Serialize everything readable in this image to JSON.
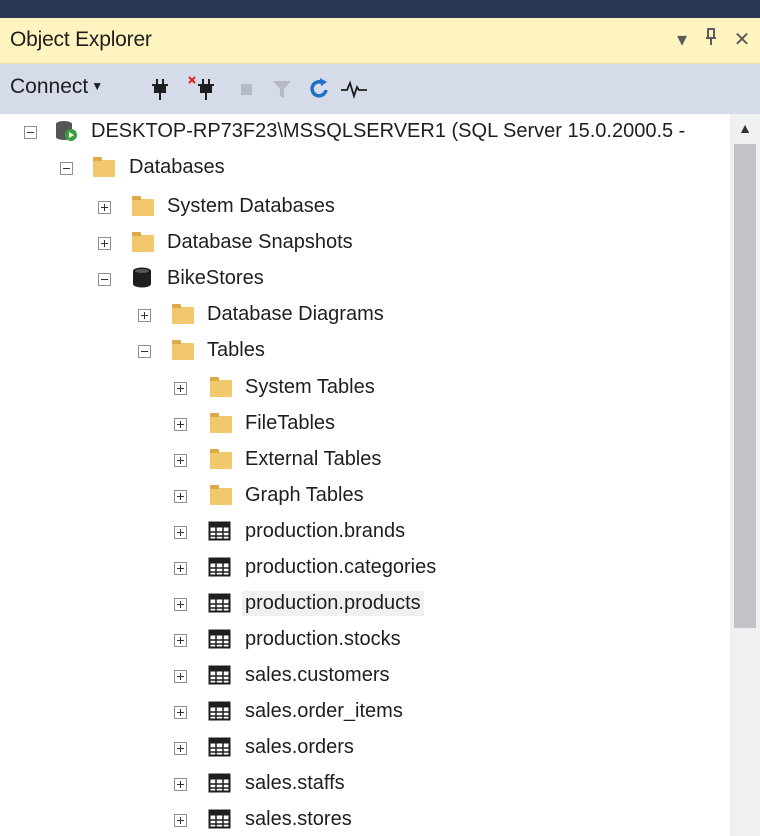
{
  "panel": {
    "title": "Object Explorer",
    "controls": [
      "▾",
      "⊥",
      "✕"
    ]
  },
  "toolbar": {
    "connect_label": "Connect",
    "buttons": [
      "connect-plug-icon",
      "disconnect-plug-icon",
      "stop-icon",
      "filter-icon",
      "refresh-icon",
      "activity-monitor-icon"
    ]
  },
  "tree": {
    "server": "DESKTOP-RP73F23\\MSSQLSERVER1 (SQL Server 15.0.2000.5 -",
    "databases": "Databases",
    "system_databases": "System Databases",
    "database_snapshots": "Database Snapshots",
    "bikestores": "BikeStores",
    "database_diagrams": "Database Diagrams",
    "tables": "Tables",
    "table_folders": [
      "System Tables",
      "FileTables",
      "External Tables",
      "Graph Tables"
    ],
    "table_items": [
      "production.brands",
      "production.categories",
      "production.products",
      "production.stocks",
      "sales.customers",
      "sales.order_items",
      "sales.orders",
      "sales.staffs",
      "sales.stores"
    ],
    "selected_item": "production.products"
  },
  "colors": {
    "title_bg": "#fdf4bf",
    "toolbar_bg": "#d6dbe9",
    "folder": "#f1c96c",
    "top_strip": "#293955"
  }
}
